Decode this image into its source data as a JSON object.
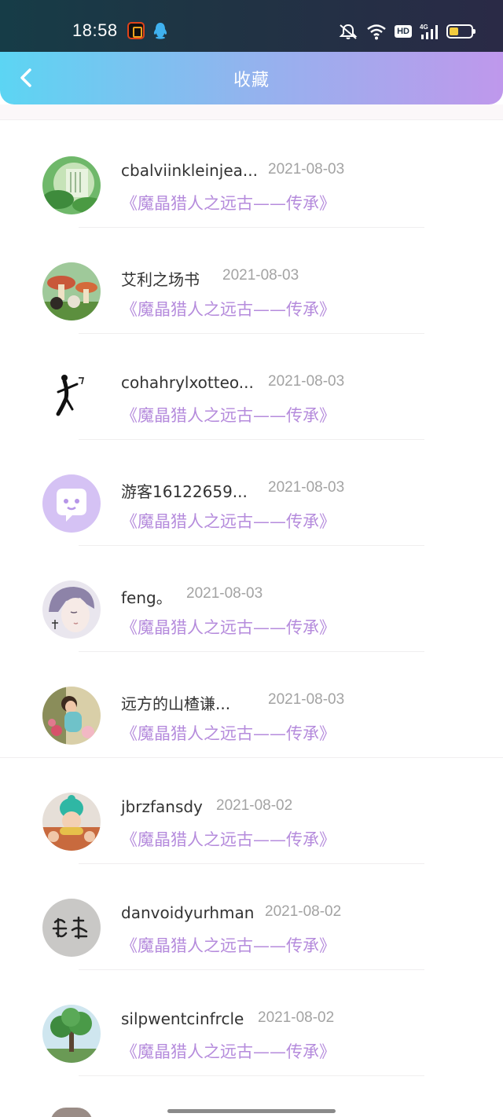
{
  "status_bar": {
    "time": "18:58",
    "icons": [
      "app-icon",
      "qq-icon",
      "mute-icon",
      "wifi-icon",
      "hd-icon",
      "signal-4g-icon",
      "battery-icon"
    ],
    "hd_label": "HD"
  },
  "nav": {
    "back_icon": "chevron-left-icon",
    "title": "收藏"
  },
  "colors": {
    "nav_gradient_start": "#5cd5f3",
    "nav_gradient_end": "#bf98ec",
    "book_title": "#b58bdc",
    "date": "#a3a3a3",
    "name": "#333333"
  },
  "items": [
    {
      "name": "cbalviinkleinjea...",
      "date": "2021-08-03",
      "book": "《魔晶猎人之远古——传承》",
      "avatar": "green-landscape-avatar"
    },
    {
      "name": "艾利之场书",
      "date": "2021-08-03",
      "book": "《魔晶猎人之远古——传承》",
      "avatar": "mushroom-avatar"
    },
    {
      "name": "cohahrylxotteo...",
      "date": "2021-08-03",
      "book": "《魔晶猎人之远古——传承》",
      "avatar": "stick-figure-avatar"
    },
    {
      "name": "游客16122659...",
      "date": "2021-08-03",
      "book": "《魔晶猎人之远古——传承》",
      "avatar": "default-chat-avatar"
    },
    {
      "name": "feng。",
      "date": "2021-08-03",
      "book": "《魔晶猎人之远古——传承》",
      "avatar": "anime-boy-avatar"
    },
    {
      "name": "远方的山楂谦...",
      "date": "2021-08-03",
      "book": "《魔晶猎人之远古——传承》",
      "avatar": "girl-flowers-avatar"
    },
    {
      "name": "jbrzfansdy",
      "date": "2021-08-02",
      "book": "《魔晶猎人之远古——传承》",
      "avatar": "green-hat-girl-avatar"
    },
    {
      "name": "danvoidyurhman",
      "date": "2021-08-02",
      "book": "《魔晶猎人之远古——传承》",
      "avatar": "calligraphy-avatar"
    },
    {
      "name": "silpwentcinfrcle",
      "date": "2021-08-02",
      "book": "《魔晶猎人之远古——传承》",
      "avatar": "tree-avatar"
    }
  ]
}
